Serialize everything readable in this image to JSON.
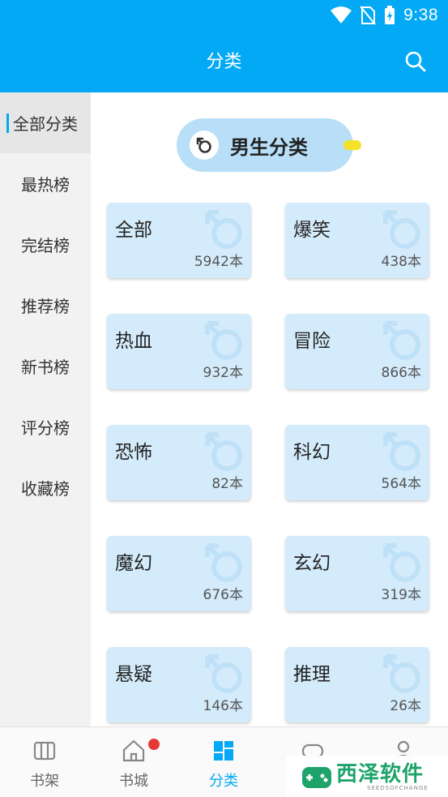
{
  "status_bar": {
    "time": "9:38"
  },
  "app_bar": {
    "title": "分类",
    "search_icon": "search-icon"
  },
  "sidebar": {
    "items": [
      {
        "label": "全部分类",
        "active": true
      },
      {
        "label": "最热榜"
      },
      {
        "label": "完结榜"
      },
      {
        "label": "推荐榜"
      },
      {
        "label": "新书榜"
      },
      {
        "label": "评分榜"
      },
      {
        "label": "收藏榜"
      }
    ]
  },
  "gender_toggle": {
    "label": "男生分类",
    "icon": "male-icon"
  },
  "categories": [
    {
      "name": "全部",
      "count": "5942本"
    },
    {
      "name": "爆笑",
      "count": "438本"
    },
    {
      "name": "热血",
      "count": "932本"
    },
    {
      "name": "冒险",
      "count": "866本"
    },
    {
      "name": "恐怖",
      "count": "82本"
    },
    {
      "name": "科幻",
      "count": "564本"
    },
    {
      "name": "魔幻",
      "count": "676本"
    },
    {
      "name": "玄幻",
      "count": "319本"
    },
    {
      "name": "悬疑",
      "count": "146本"
    },
    {
      "name": "推理",
      "count": "26本"
    }
  ],
  "bottom_nav": {
    "items": [
      {
        "label": "书架",
        "icon": "bookshelf-icon"
      },
      {
        "label": "书城",
        "icon": "home-icon",
        "badge": true
      },
      {
        "label": "分类",
        "icon": "grid-icon",
        "active": true
      },
      {
        "label": "",
        "icon": "gamepad-icon"
      },
      {
        "label": "",
        "icon": "profile-icon"
      }
    ]
  },
  "watermark": {
    "title": "西泽软件",
    "subtitle": "SEEDSOFCHANGE"
  },
  "colors": {
    "primary": "#03A9F4",
    "card_bg": "#d4ebfb",
    "pill_bg": "#b8dff7",
    "badge": "#e53935"
  }
}
